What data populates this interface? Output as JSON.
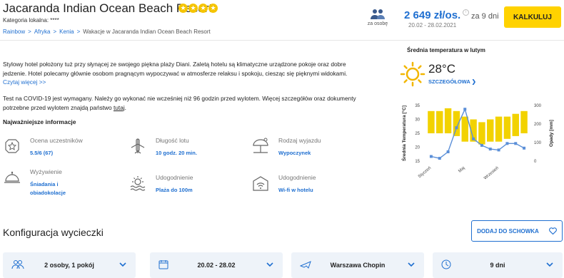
{
  "hotel": {
    "name": "Jacaranda Indian Ocean Beach Resort",
    "stars": 4,
    "category": "Kategoria lokalna: ****"
  },
  "breadcrumb": {
    "items": [
      "Rainbow",
      "Afryka",
      "Kenia"
    ],
    "current": "Wakacje w Jacaranda Indian Ocean Beach Resort",
    "separator": ">"
  },
  "pricing": {
    "per_person_label": "za osobę",
    "price": "2 649 zł/os.",
    "dates": "20.02 - 28.02.2021",
    "duration": "za 9 dni",
    "calc_button": "KALKULUJ"
  },
  "description": {
    "text": "Stylowy hotel położony tuż przy słynącej ze swojego piękna plaży Diani. Zaletą hotelu są klimatyczne urządzone pokoje oraz dobre jedzenie. Hotel polecamy głównie osobom pragnącym wypoczywać w atmosferze relaksu i spokoju, ciesząc się pięknymi widokami.",
    "more_link": "Czytaj więcej >>"
  },
  "covid": {
    "text": "Test na COVID-19 jest wymagany. Należy go wykonać nie wcześniej niż 96 godzin przed wylotem. Więcej szczegółów oraz dokumenty potrzebne przed wylotem znajdą państwo",
    "link": "tutaj",
    "end": "."
  },
  "key_info": {
    "title": "Najważniejsze informacje",
    "items": [
      {
        "icon": "star-shield-icon",
        "label": "Ocena uczestników",
        "value": "5.5/6 (67)"
      },
      {
        "icon": "airplane-icon",
        "label": "Długość lotu",
        "value": "10 godz. 20 min."
      },
      {
        "icon": "beach-umbrella-icon",
        "label": "Rodzaj wyjazdu",
        "value": "Wypoczynek"
      },
      {
        "icon": "food-cloche-icon",
        "label": "Wyżywienie",
        "value": "Śniadania i obiadokolacje"
      },
      {
        "icon": "beach-sun-icon",
        "label": "Udogodnienie",
        "value": "Plaża do 100m"
      },
      {
        "icon": "wifi-icon",
        "label": "Udogodnienie",
        "value": "Wi-fi w hotelu"
      }
    ]
  },
  "weather": {
    "title": "Średnia temperatura w lutym",
    "temperature": "28°C",
    "details_link": "SZCZEGÓŁOWA",
    "icon": "sun-icon"
  },
  "chart_data": {
    "type": "bar",
    "months": 12,
    "x_tick_labels": [
      "Styczeń",
      "Maj",
      "Wrzesień"
    ],
    "ylabel": "Średnia Temperatura [°C]",
    "ylabel_right": "Opady [mm]",
    "y_ticks": [
      15,
      20,
      25,
      30,
      35
    ],
    "y_right_ticks": [
      0,
      100,
      200,
      300
    ],
    "series": [
      {
        "name": "temperature",
        "type": "bar-range",
        "low": [
          25,
          25,
          25,
          24,
          22,
          22,
          21,
          22,
          22,
          23,
          24,
          25
        ],
        "high": [
          33,
          33,
          34,
          33,
          31,
          30,
          29,
          30,
          31,
          31,
          32,
          33
        ]
      },
      {
        "name": "precipitation",
        "type": "line",
        "values": [
          25,
          15,
          50,
          180,
          280,
          120,
          85,
          65,
          60,
          95,
          95,
          70
        ]
      }
    ],
    "colors": {
      "bars": "#f2d200",
      "line": "#5b8fd8"
    }
  },
  "config": {
    "title": "Konfiguracja wycieczki",
    "save_button": "DODAJ DO SCHOWKA"
  },
  "filters": [
    {
      "icon": "people-icon",
      "value": "2 osoby, 1 pokój"
    },
    {
      "icon": "calendar-icon",
      "value": "20.02 - 28.02"
    },
    {
      "icon": "plane-icon",
      "value": "Warszawa Chopin"
    },
    {
      "icon": "clock-icon",
      "value": "9 dni"
    }
  ]
}
